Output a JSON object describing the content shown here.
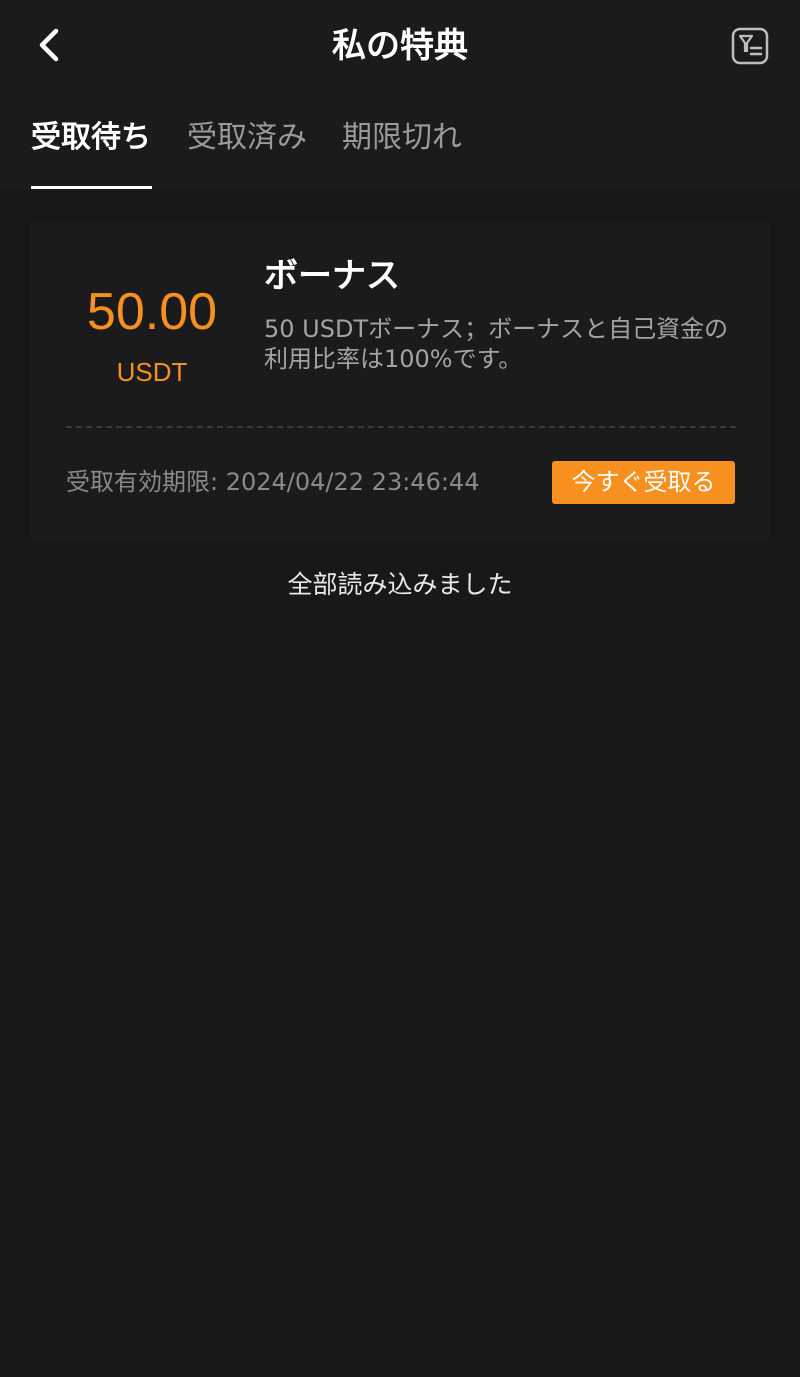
{
  "header": {
    "title": "私の特典",
    "back_icon": "chevron-left-icon",
    "filter_icon": "filter-list-icon"
  },
  "tabs": [
    {
      "label": "受取待ち",
      "active": true
    },
    {
      "label": "受取済み",
      "active": false
    },
    {
      "label": "期限切れ",
      "active": false
    }
  ],
  "bonus_card": {
    "amount": "50.00",
    "currency": "USDT",
    "title": "ボーナス",
    "description": "50 USDTボーナス；ボーナスと自己資金の利用比率は100%です。",
    "expiry": "受取有効期限: 2024/04/22 23:46:44",
    "claim_label": "今すぐ受取る"
  },
  "list_footer": "全部読み込みました",
  "colors": {
    "background": "#181818",
    "accent": "#f7901e",
    "text_primary": "#ffffff",
    "text_secondary": "#9a9a9a"
  }
}
